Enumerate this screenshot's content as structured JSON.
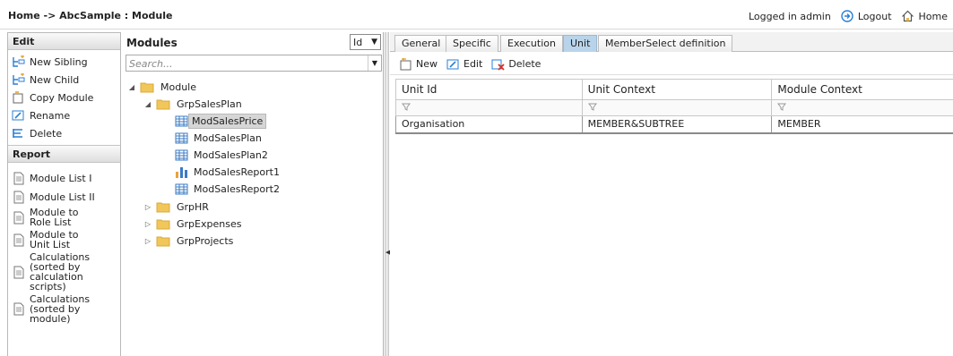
{
  "header": {
    "breadcrumb": "Home -> AbcSample : Module",
    "logged_in": "Logged in admin",
    "logout": "Logout",
    "home": "Home"
  },
  "edit_section": {
    "title": "Edit",
    "items": [
      {
        "label": "New Sibling",
        "icon": "new-sibling-icon"
      },
      {
        "label": "New Child",
        "icon": "new-child-icon"
      },
      {
        "label": "Copy Module",
        "icon": "copy-icon"
      },
      {
        "label": "Rename",
        "icon": "rename-icon"
      },
      {
        "label": "Delete",
        "icon": "delete-icon"
      }
    ]
  },
  "report_section": {
    "title": "Report",
    "items": [
      {
        "label": "Module List I"
      },
      {
        "label": "Module List II"
      },
      {
        "label": "Module to Role List"
      },
      {
        "label": "Module to Unit List"
      },
      {
        "label": "Calculations (sorted by calculation scripts)"
      },
      {
        "label": "Calculations (sorted by module)"
      }
    ]
  },
  "modules": {
    "title": "Modules",
    "select_value": "Id",
    "search_placeholder": "Search...",
    "tree": [
      {
        "label": "Module",
        "type": "folder",
        "expanded": true
      },
      {
        "label": "GrpSalesPlan",
        "type": "folder",
        "expanded": true
      },
      {
        "label": "ModSalesPrice",
        "type": "table",
        "selected": true
      },
      {
        "label": "ModSalesPlan",
        "type": "table"
      },
      {
        "label": "ModSalesPlan2",
        "type": "table"
      },
      {
        "label": "ModSalesReport1",
        "type": "chart"
      },
      {
        "label": "ModSalesReport2",
        "type": "table"
      },
      {
        "label": "GrpHR",
        "type": "folder",
        "expanded": false
      },
      {
        "label": "GrpExpenses",
        "type": "folder",
        "expanded": false
      },
      {
        "label": "GrpProjects",
        "type": "folder",
        "expanded": false
      }
    ]
  },
  "tabs": [
    "General",
    "Specific",
    "Execution",
    "Unit",
    "MemberSelect definition"
  ],
  "active_tab": "Unit",
  "toolbar": {
    "new": "New",
    "edit": "Edit",
    "delete": "Delete"
  },
  "grid": {
    "columns": [
      "Unit Id",
      "Unit Context",
      "Module Context"
    ],
    "rows": [
      [
        "Organisation",
        "MEMBER&SUBTREE",
        "MEMBER"
      ]
    ]
  }
}
